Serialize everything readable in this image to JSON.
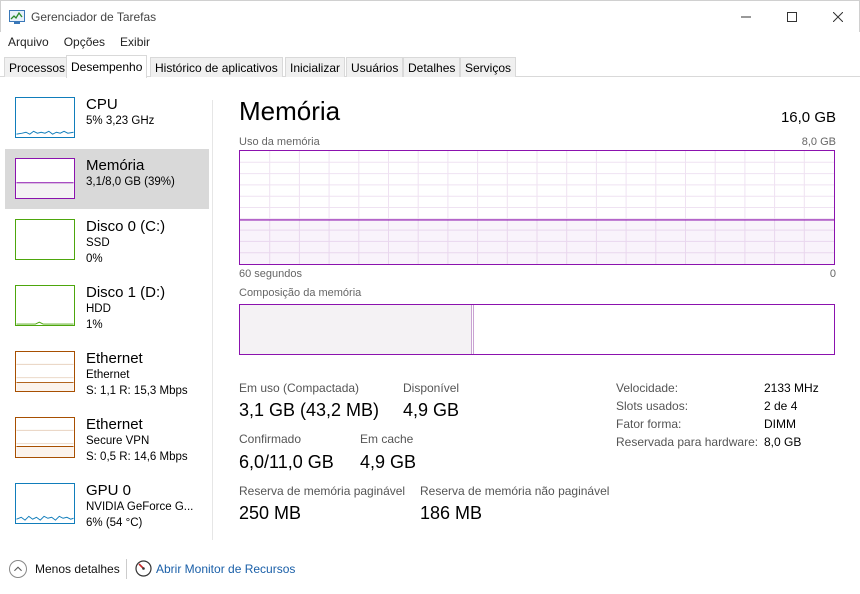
{
  "window": {
    "title": "Gerenciador de Tarefas",
    "controls": [
      "minimize-icon",
      "maximize-icon",
      "close-icon"
    ]
  },
  "menu": [
    "Arquivo",
    "Opções",
    "Exibir"
  ],
  "tabs": [
    "Processos",
    "Desempenho",
    "Histórico de aplicativos",
    "Inicializar",
    "Usuários",
    "Detalhes",
    "Serviços"
  ],
  "active_tab": "Desempenho",
  "sidebar": [
    {
      "name": "CPU",
      "line1": "5%  3,23 GHz",
      "line2": "",
      "color": "#117dbb"
    },
    {
      "name": "Memória",
      "line1": "3,1/8,0 GB (39%)",
      "line2": "",
      "color": "#8b12ae",
      "selected": true
    },
    {
      "name": "Disco 0 (C:)",
      "line1": "SSD",
      "line2": "0%",
      "color": "#4da60c"
    },
    {
      "name": "Disco 1 (D:)",
      "line1": "HDD",
      "line2": "1%",
      "color": "#4da60c"
    },
    {
      "name": "Ethernet",
      "line1": "Ethernet",
      "line2": "S: 1,1  R: 15,3 Mbps",
      "color": "#a74f01"
    },
    {
      "name": "Ethernet",
      "line1": "Secure VPN",
      "line2": "S: 0,5  R: 14,6 Mbps",
      "color": "#a74f01"
    },
    {
      "name": "GPU 0",
      "line1": "NVIDIA GeForce G...",
      "line2": "6% (54 °C)",
      "color": "#117dbb"
    }
  ],
  "memory": {
    "title": "Memória",
    "total": "16,0 GB",
    "usage_label": "Uso da memória",
    "usage_max": "8,0 GB",
    "time_left": "60 segundos",
    "time_right": "0",
    "usage_fraction": 0.39,
    "composition_label": "Composição da memória",
    "composition_inuse_fraction": 0.39,
    "composition_modified_fraction": 0.003,
    "accent": "#8b12ae",
    "stats": {
      "inuse_label": "Em uso (Compactada)",
      "inuse_value": "3,1 GB (43,2 MB)",
      "available_label": "Disponível",
      "available_value": "4,9 GB",
      "committed_label": "Confirmado",
      "committed_value": "6,0/11,0 GB",
      "cached_label": "Em cache",
      "cached_value": "4,9 GB",
      "paged_label": "Reserva de memória paginável",
      "paged_value": "250 MB",
      "nonpaged_label": "Reserva de memória não paginável",
      "nonpaged_value": "186 MB"
    },
    "props": [
      {
        "label": "Velocidade:",
        "value": "2133 MHz"
      },
      {
        "label": "Slots usados:",
        "value": "2 de 4"
      },
      {
        "label": "Fator forma:",
        "value": "DIMM"
      },
      {
        "label": "Reservada para hardware:",
        "value": "8,0 GB"
      }
    ]
  },
  "footer": {
    "less_details": "Menos detalhes",
    "open_resmon": "Abrir Monitor de Recursos"
  }
}
